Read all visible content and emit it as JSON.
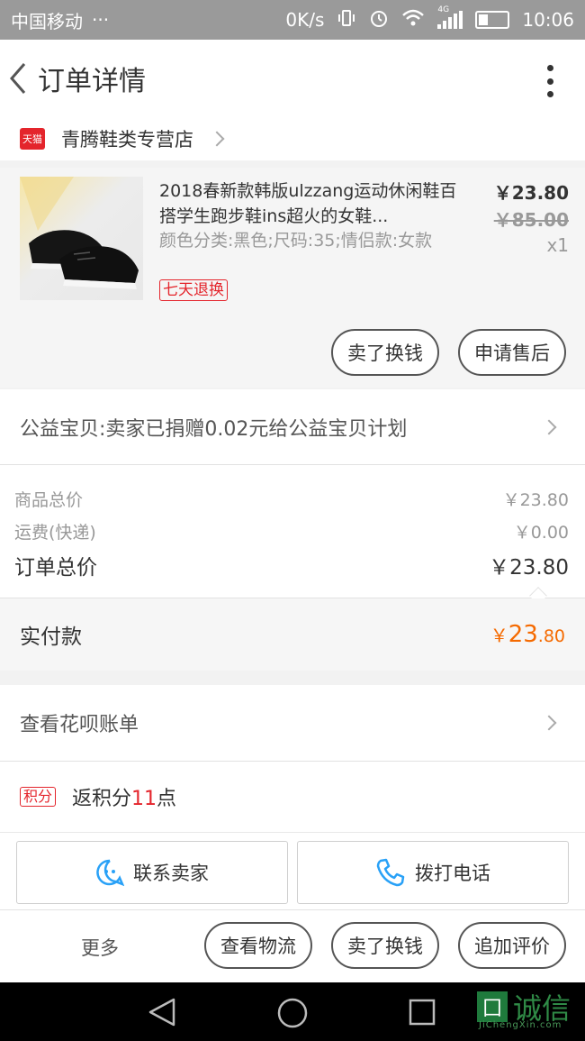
{
  "status_bar": {
    "carrier": "中国移动",
    "dots": "···",
    "speed": "0K/s",
    "network": "4G",
    "time": "10:06"
  },
  "header": {
    "title": "订单详情"
  },
  "store": {
    "logo_text": "天猫",
    "name": "青腾鞋类专营店"
  },
  "product": {
    "title": "2018春新款韩版ulzzang运动休闲鞋百搭学生跑步鞋ins超火的女鞋...",
    "sku": "颜色分类:黑色;尺码:35;情侣款:女款",
    "tag": "七天退换",
    "price": "￥23.80",
    "original_price": "￥85.00",
    "quantity": "x1",
    "buttons": [
      "卖了换钱",
      "申请售后"
    ]
  },
  "charity": {
    "text": "公益宝贝:卖家已捐赠0.02元给公益宝贝计划"
  },
  "summary": {
    "rows": [
      {
        "label": "商品总价",
        "value": "￥23.80"
      },
      {
        "label": "运费(快递)",
        "value": "￥0.00"
      },
      {
        "label": "订单总价",
        "value": "￥23.80"
      }
    ]
  },
  "paid": {
    "label": "实付款",
    "currency": "￥",
    "integer": "23",
    "decimal": ".80"
  },
  "huabei": {
    "text": "查看花呗账单"
  },
  "points": {
    "tag": "积分",
    "prefix": "返积分",
    "number": "11",
    "suffix": "点"
  },
  "contact": {
    "seller": "联系卖家",
    "phone": "拨打电话"
  },
  "actions": {
    "more": "更多",
    "buttons": [
      "查看物流",
      "卖了换钱",
      "追加评价"
    ]
  },
  "watermark": {
    "char": "囗",
    "text": "诚信",
    "sub": "JiChengXin.com"
  },
  "colors": {
    "accent_orange": "#f56a00",
    "tmall_red": "#e4252c",
    "contact_blue": "#29a1f7",
    "status_grey": "#9a9a9a"
  }
}
